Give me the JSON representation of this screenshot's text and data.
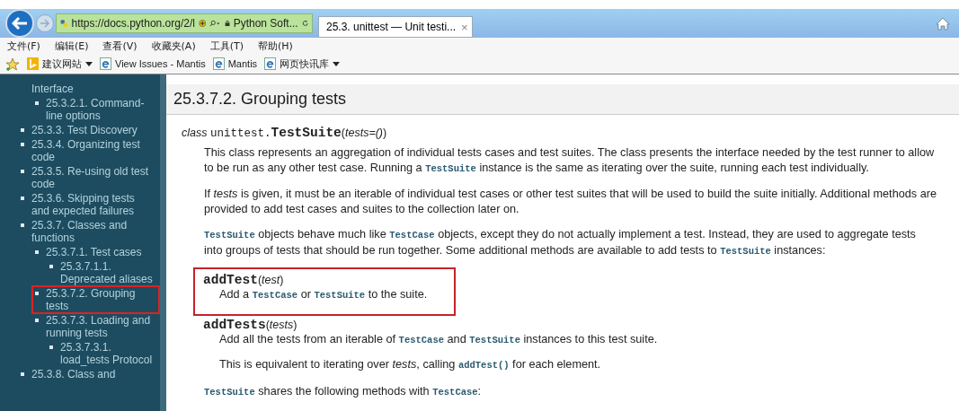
{
  "browser": {
    "address_bar": {
      "url": "https://docs.python.org/2/l",
      "site_identity": "Python Soft..."
    },
    "tabs": [
      {
        "title": "25.3. unittest — Unit testi...",
        "close": "×",
        "selected": true
      }
    ],
    "menu": [
      "文件(F)",
      "编辑(E)",
      "查看(V)",
      "收藏夹(A)",
      "工具(T)",
      "帮助(H)"
    ],
    "favorites": [
      {
        "label": "建议网站",
        "kind": "bing",
        "dropdown": true
      },
      {
        "label": "View Issues - Mantis",
        "kind": "page",
        "dropdown": false
      },
      {
        "label": "Mantis",
        "kind": "page",
        "dropdown": false
      },
      {
        "label": "网页快讯库",
        "kind": "page",
        "dropdown": true
      }
    ]
  },
  "sidebar": {
    "items": [
      {
        "text": "Interface",
        "kind": "continued",
        "marked": false,
        "children": [
          {
            "text": "25.3.2.1. Command-line options",
            "kind": "item",
            "marked": false
          }
        ]
      },
      {
        "text": "25.3.3. Test Discovery",
        "kind": "item",
        "marked": false
      },
      {
        "text": "25.3.4. Organizing test code",
        "kind": "item",
        "marked": false
      },
      {
        "text": "25.3.5. Re-using old test code",
        "kind": "item",
        "marked": false
      },
      {
        "text": "25.3.6. Skipping tests and expected failures",
        "kind": "item",
        "marked": false
      },
      {
        "text": "25.3.7. Classes and functions",
        "kind": "item",
        "marked": false,
        "children": [
          {
            "text": "25.3.7.1. Test cases",
            "kind": "item",
            "marked": false,
            "children": [
              {
                "text": "25.3.7.1.1. Deprecated aliases",
                "kind": "item",
                "marked": false
              }
            ]
          },
          {
            "text": "25.3.7.2. Grouping tests",
            "kind": "item",
            "marked": true
          },
          {
            "text": "25.3.7.3. Loading and running tests",
            "kind": "item",
            "marked": false,
            "children": [
              {
                "text": "25.3.7.3.1. load_tests Protocol",
                "kind": "item",
                "marked": false
              }
            ]
          }
        ]
      },
      {
        "text": "25.3.8. Class and",
        "kind": "item",
        "marked": false
      }
    ]
  },
  "page": {
    "heading": "25.3.7.2. Grouping tests",
    "signature": {
      "keyword": "class",
      "module": "unittest.",
      "name": "TestSuite",
      "params": "(*tests=()*)"
    },
    "paragraphs": [
      [
        [
          {
            "kind": "text",
            "text": "This class represents an aggregation of individual tests cases and test suites. The class presents the interface needed by the test runner to allow"
          }
        ],
        [
          {
            "kind": "text",
            "text": "to be run as any other test case. Running a "
          },
          {
            "kind": "code",
            "text": "TestSuite"
          },
          {
            "kind": "text",
            "text": " instance is the same as iterating over the suite, running each test individually."
          }
        ]
      ],
      [
        [
          {
            "kind": "text",
            "text": "If "
          },
          {
            "kind": "em",
            "text": "tests"
          },
          {
            "kind": "text",
            "text": " is given, it must be an iterable of individual test cases or other test suites that will be used to build the suite initially. Additional methods are"
          }
        ],
        [
          {
            "kind": "text",
            "text": "provided to add test cases and suites to the collection later on."
          }
        ]
      ],
      [
        [
          {
            "kind": "code",
            "text": "TestSuite"
          },
          {
            "kind": "text",
            "text": " objects behave much like "
          },
          {
            "kind": "code",
            "text": "TestCase"
          },
          {
            "kind": "text",
            "text": " objects, except they do not actually implement a test. Instead, they are used to aggregate tests"
          }
        ],
        [
          {
            "kind": "text",
            "text": "into groups of tests that should be run together. Some additional methods are available to add tests to "
          },
          {
            "kind": "code",
            "text": "TestSuite"
          },
          {
            "kind": "text",
            "text": " instances:"
          }
        ]
      ]
    ],
    "methods": [
      {
        "name": "addTest",
        "params": "(*test*)",
        "marked": true,
        "paragraphs": [
          [
            [
              {
                "kind": "text",
                "text": "Add a "
              },
              {
                "kind": "code",
                "text": "TestCase"
              },
              {
                "kind": "text",
                "text": " or "
              },
              {
                "kind": "code",
                "text": "TestSuite"
              },
              {
                "kind": "text",
                "text": " to the suite."
              }
            ]
          ]
        ]
      },
      {
        "name": "addTests",
        "params": "(*tests*)",
        "marked": false,
        "paragraphs": [
          [
            [
              {
                "kind": "text",
                "text": "Add all the tests from an iterable of "
              },
              {
                "kind": "code",
                "text": "TestCase"
              },
              {
                "kind": "text",
                "text": " and "
              },
              {
                "kind": "code",
                "text": "TestSuite"
              },
              {
                "kind": "text",
                "text": " instances to this test suite."
              }
            ]
          ],
          [
            [
              {
                "kind": "text",
                "text": "This is equivalent to iterating over "
              },
              {
                "kind": "em",
                "text": "tests"
              },
              {
                "kind": "text",
                "text": ", calling "
              },
              {
                "kind": "code",
                "text": "addTest()"
              },
              {
                "kind": "text",
                "text": " for each element."
              }
            ]
          ]
        ]
      }
    ],
    "closing": [
      {
        "kind": "code",
        "text": "TestSuite"
      },
      {
        "kind": "text",
        "text": " shares the following methods with "
      },
      {
        "kind": "code",
        "text": "TestCase"
      },
      {
        "kind": "text",
        "text": ":"
      }
    ]
  }
}
